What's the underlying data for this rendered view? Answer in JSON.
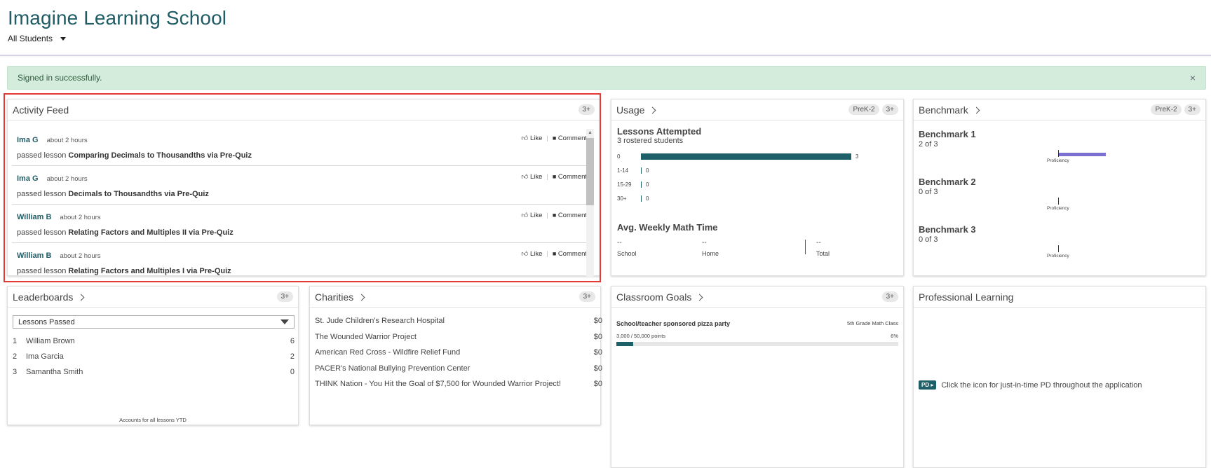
{
  "header": {
    "title": "Imagine Learning School",
    "student_filter": "All Students"
  },
  "alert": {
    "message": "Signed in successfully.",
    "close": "×"
  },
  "activity_feed": {
    "title": "Activity Feed",
    "badge": "3+",
    "like_label": "Like",
    "comment_label": "Comment",
    "items": [
      {
        "name": "Ima G",
        "time": "about 2 hours",
        "prefix": "passed lesson",
        "lesson": "Comparing Decimals to Thousandths via Pre-Quiz"
      },
      {
        "name": "Ima G",
        "time": "about 2 hours",
        "prefix": "passed lesson",
        "lesson": "Decimals to Thousandths via Pre-Quiz"
      },
      {
        "name": "William B",
        "time": "about 2 hours",
        "prefix": "passed lesson",
        "lesson": "Relating Factors and Multiples II via Pre-Quiz"
      },
      {
        "name": "William B",
        "time": "about 2 hours",
        "prefix": "passed lesson",
        "lesson": "Relating Factors and Multiples I via Pre-Quiz"
      }
    ]
  },
  "usage": {
    "title": "Usage",
    "badges": [
      "PreK-2",
      "3+"
    ],
    "lessons_heading": "Lessons Attempted",
    "lessons_sub": "3 rostered students",
    "bars": [
      {
        "label": "0",
        "value": "3",
        "fraction": 1.0
      },
      {
        "label": "1-14",
        "value": "0",
        "fraction": 0
      },
      {
        "label": "15-29",
        "value": "0",
        "fraction": 0
      },
      {
        "label": "30+",
        "value": "0",
        "fraction": 0
      }
    ],
    "weekly_heading": "Avg. Weekly Math Time",
    "weekly": [
      {
        "value": "--",
        "label": "School"
      },
      {
        "value": "--",
        "label": "Home"
      },
      {
        "value": "--",
        "label": "Total"
      }
    ]
  },
  "benchmark": {
    "title": "Benchmark",
    "badges": [
      "PreK-2",
      "3+"
    ],
    "proficiency_label": "Proficiency",
    "items": [
      {
        "title": "Benchmark 1",
        "sub": "2 of 3",
        "fraction": 0.667
      },
      {
        "title": "Benchmark 2",
        "sub": "0 of 3",
        "fraction": 0
      },
      {
        "title": "Benchmark 3",
        "sub": "0 of 3",
        "fraction": 0
      }
    ]
  },
  "leaderboards": {
    "title": "Leaderboards",
    "badge": "3+",
    "selected": "Lessons Passed",
    "rows": [
      {
        "rank": "1",
        "name": "William Brown",
        "score": "6"
      },
      {
        "rank": "2",
        "name": "Ima Garcia",
        "score": "2"
      },
      {
        "rank": "3",
        "name": "Samantha Smith",
        "score": "0"
      }
    ],
    "footer": "Accounts for all lessons YTD"
  },
  "charities": {
    "title": "Charities",
    "badge": "3+",
    "rows": [
      {
        "name": "St. Jude Children's Research Hospital",
        "amount": "$0"
      },
      {
        "name": "The Wounded Warrior Project",
        "amount": "$0"
      },
      {
        "name": "American Red Cross - Wildfire Relief Fund",
        "amount": "$0"
      },
      {
        "name": "PACER's National Bullying Prevention Center",
        "amount": "$0"
      },
      {
        "name": "THINK Nation - You Hit the Goal of $7,500 for Wounded Warrior Project!",
        "amount": "$0"
      }
    ]
  },
  "classroom_goals": {
    "title": "Classroom Goals",
    "badge": "3+",
    "goal_name": "School/teacher sponsored pizza party",
    "goal_class": "5th Grade Math Class",
    "goal_points": "3,000 / 50,000 points",
    "goal_percent": "6%",
    "goal_fraction": 0.06
  },
  "professional_learning": {
    "title": "Professional Learning",
    "pd_badge": "PD ▸",
    "text": "Click the icon for just-in-time PD throughout the application"
  }
}
